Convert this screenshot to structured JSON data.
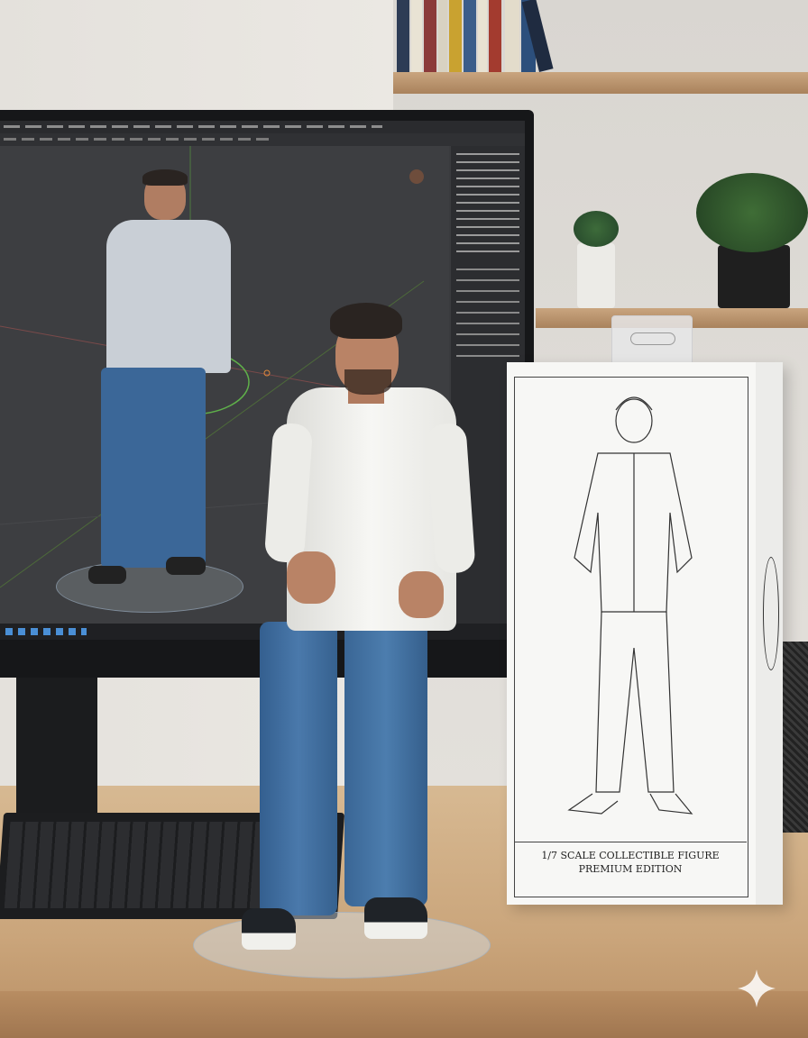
{
  "scene": {
    "description_items": [
      "monitor",
      "keyboard",
      "collectible-figure",
      "figure-box",
      "bookshelf",
      "plants"
    ]
  },
  "box": {
    "line1": "1/7 SCALE COLLECTIBLE FIGURE",
    "line2": "PREMIUM EDITION"
  },
  "colors": {
    "shirt": "#f2f2ef",
    "jeans": "#3e6c9e",
    "skin": "#b98366",
    "hair": "#2a2421",
    "viewport": "#3d3e41"
  }
}
